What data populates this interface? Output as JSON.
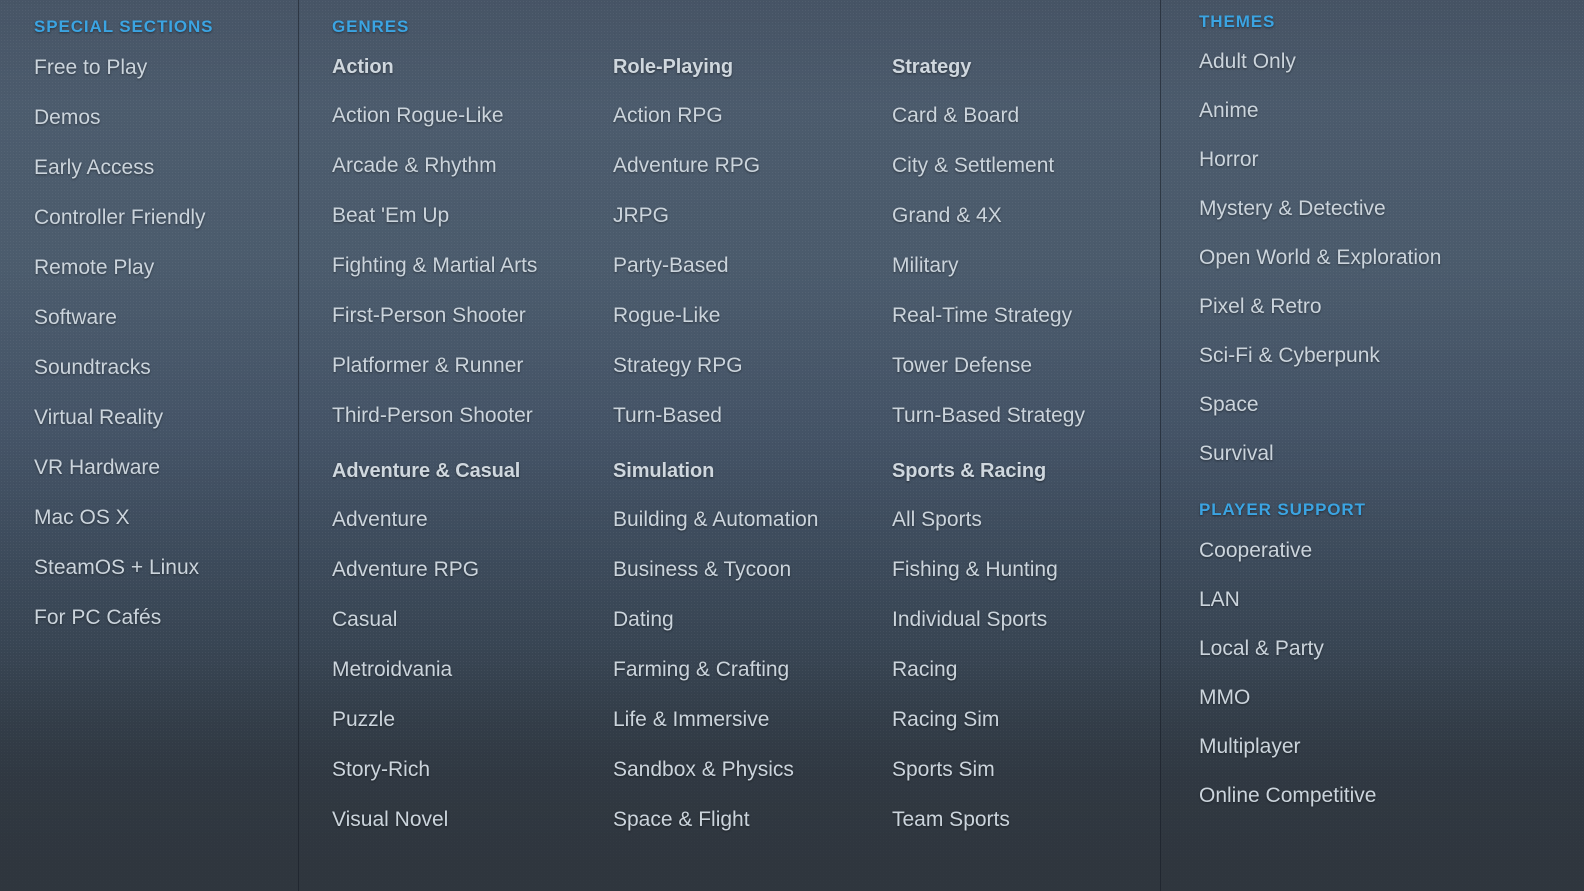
{
  "theme": {
    "accent_blue": "#3ba4e2",
    "link_color": "#cbd4dc",
    "bg_top": "#414d5d",
    "bg_mid": "#4a5a6b",
    "bg_bottom": "#2f363e"
  },
  "special_sections": {
    "heading": "SPECIAL SECTIONS",
    "items": [
      "Free to Play",
      "Demos",
      "Early Access",
      "Controller Friendly",
      "Remote Play",
      "Software",
      "Soundtracks",
      "Virtual Reality",
      "VR Hardware",
      "Mac OS X",
      "SteamOS + Linux",
      "For PC Cafés"
    ]
  },
  "genres": {
    "heading": "GENRES",
    "groups": [
      {
        "title": "Action",
        "items": [
          "Action Rogue-Like",
          "Arcade & Rhythm",
          "Beat 'Em Up",
          "Fighting & Martial Arts",
          "First-Person Shooter",
          "Platformer & Runner",
          "Third-Person Shooter"
        ]
      },
      {
        "title": "Role-Playing",
        "items": [
          "Action RPG",
          "Adventure RPG",
          "JRPG",
          "Party-Based",
          "Rogue-Like",
          "Strategy RPG",
          "Turn-Based"
        ]
      },
      {
        "title": "Strategy",
        "items": [
          "Card & Board",
          "City & Settlement",
          "Grand & 4X",
          "Military",
          "Real-Time Strategy",
          "Tower Defense",
          "Turn-Based Strategy"
        ]
      },
      {
        "title": "Adventure & Casual",
        "items": [
          "Adventure",
          "Adventure RPG",
          "Casual",
          "Metroidvania",
          "Puzzle",
          "Story-Rich",
          "Visual Novel"
        ]
      },
      {
        "title": "Simulation",
        "items": [
          "Building & Automation",
          "Business & Tycoon",
          "Dating",
          "Farming & Crafting",
          "Life & Immersive",
          "Sandbox & Physics",
          "Space & Flight"
        ]
      },
      {
        "title": "Sports & Racing",
        "items": [
          "All Sports",
          "Fishing & Hunting",
          "Individual Sports",
          "Racing",
          "Racing Sim",
          "Sports Sim",
          "Team Sports"
        ]
      }
    ]
  },
  "themes": {
    "heading": "THEMES",
    "items": [
      "Adult Only",
      "Anime",
      "Horror",
      "Mystery & Detective",
      "Open World & Exploration",
      "Pixel & Retro",
      "Sci-Fi & Cyberpunk",
      "Space",
      "Survival"
    ]
  },
  "player_support": {
    "heading": "PLAYER SUPPORT",
    "items": [
      "Cooperative",
      "LAN",
      "Local & Party",
      "MMO",
      "Multiplayer",
      "Online Competitive"
    ]
  }
}
